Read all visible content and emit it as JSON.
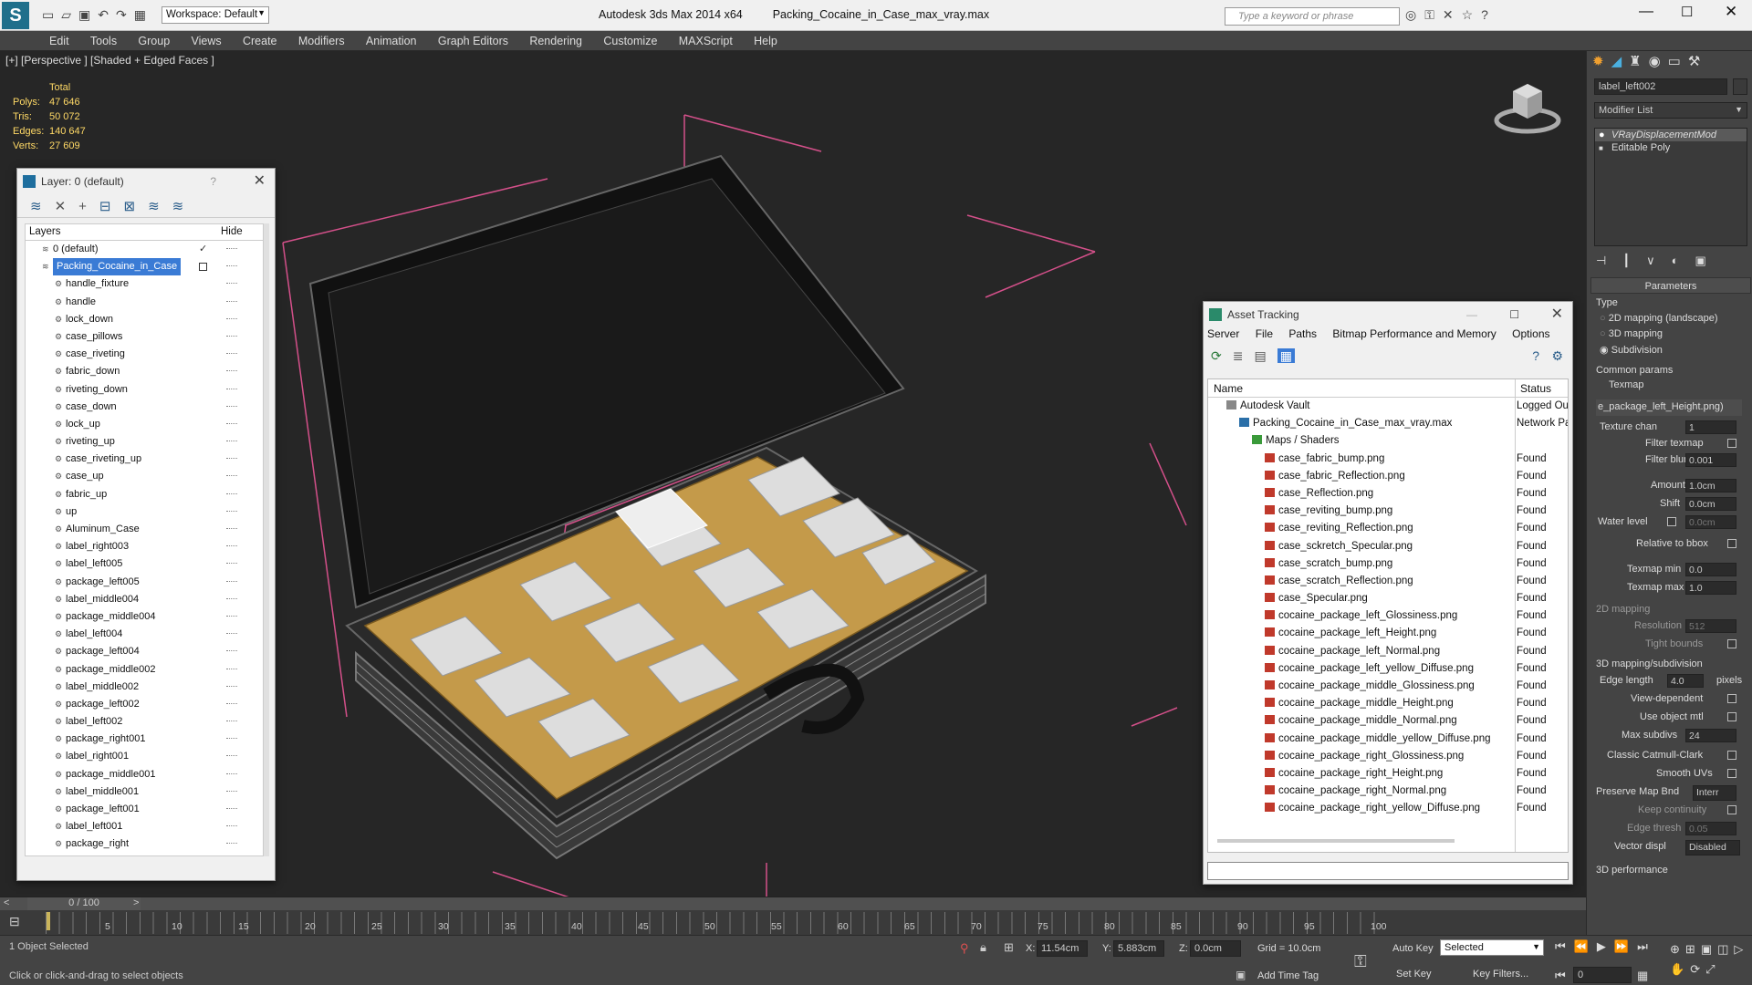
{
  "titlebar": {
    "workspace": "Workspace: Default",
    "app_title": "Autodesk 3ds Max  2014 x64",
    "file_title": "Packing_Cocaine_in_Case_max_vray.max",
    "search_placeholder": "Type a keyword or phrase"
  },
  "menu": [
    "Edit",
    "Tools",
    "Group",
    "Views",
    "Create",
    "Modifiers",
    "Animation",
    "Graph Editors",
    "Rendering",
    "Customize",
    "MAXScript",
    "Help"
  ],
  "viewport": {
    "label": "[+] [Perspective ] [Shaded + Edged Faces ]",
    "stats_header": "Total",
    "stats": [
      {
        "k": "Polys:",
        "v": "47 646"
      },
      {
        "k": "Tris:",
        "v": "50 072"
      },
      {
        "k": "Edges:",
        "v": "140 647"
      },
      {
        "k": "Verts:",
        "v": "27 609"
      }
    ]
  },
  "layer_window": {
    "title": "Layer: 0 (default)",
    "help": "?",
    "col_layers": "Layers",
    "col_hide": "Hide",
    "layers": [
      "0 (default)",
      "Packing_Cocaine_in_Case",
      "handle_fixture",
      "handle",
      "lock_down",
      "case_pillows",
      "case_riveting",
      "fabric_down",
      "riveting_down",
      "case_down",
      "lock_up",
      "riveting_up",
      "case_riveting_up",
      "case_up",
      "fabric_up",
      "up",
      "Aluminum_Case",
      "label_right003",
      "label_left005",
      "package_left005",
      "label_middle004",
      "package_middle004",
      "label_left004",
      "package_left004",
      "package_middle002",
      "label_middle002",
      "package_left002",
      "label_left002",
      "package_right001",
      "label_right001",
      "package_middle001",
      "label_middle001",
      "package_left001",
      "label_left001",
      "package_right"
    ]
  },
  "asset_window": {
    "title": "Asset Tracking",
    "menu": [
      "Server",
      "File",
      "Paths",
      "Bitmap Performance and Memory",
      "Options"
    ],
    "col_name": "Name",
    "col_status": "Status",
    "rows": [
      {
        "name": "Autodesk Vault",
        "status": "Logged Ou"
      },
      {
        "name": "Packing_Cocaine_in_Case_max_vray.max",
        "status": "Network Pa"
      },
      {
        "name": "Maps / Shaders",
        "status": ""
      },
      {
        "name": "case_fabric_bump.png",
        "status": "Found"
      },
      {
        "name": "case_fabric_Reflection.png",
        "status": "Found"
      },
      {
        "name": "case_Reflection.png",
        "status": "Found"
      },
      {
        "name": "case_reviting_bump.png",
        "status": "Found"
      },
      {
        "name": "case_reviting_Reflection.png",
        "status": "Found"
      },
      {
        "name": "case_sckretch_Specular.png",
        "status": "Found"
      },
      {
        "name": "case_scratch_bump.png",
        "status": "Found"
      },
      {
        "name": "case_scratch_Reflection.png",
        "status": "Found"
      },
      {
        "name": "case_Specular.png",
        "status": "Found"
      },
      {
        "name": "cocaine_package_left_Glossiness.png",
        "status": "Found"
      },
      {
        "name": "cocaine_package_left_Height.png",
        "status": "Found"
      },
      {
        "name": "cocaine_package_left_Normal.png",
        "status": "Found"
      },
      {
        "name": "cocaine_package_left_yellow_Diffuse.png",
        "status": "Found"
      },
      {
        "name": "cocaine_package_middle_Glossiness.png",
        "status": "Found"
      },
      {
        "name": "cocaine_package_middle_Height.png",
        "status": "Found"
      },
      {
        "name": "cocaine_package_middle_Normal.png",
        "status": "Found"
      },
      {
        "name": "cocaine_package_middle_yellow_Diffuse.png",
        "status": "Found"
      },
      {
        "name": "cocaine_package_right_Glossiness.png",
        "status": "Found"
      },
      {
        "name": "cocaine_package_right_Height.png",
        "status": "Found"
      },
      {
        "name": "cocaine_package_right_Normal.png",
        "status": "Found"
      },
      {
        "name": "cocaine_package_right_yellow_Diffuse.png",
        "status": "Found"
      }
    ]
  },
  "command_panel": {
    "object_name": "label_left002",
    "modifier_list": "Modifier List",
    "stack": [
      "VRayDisplacementMod",
      "Editable Poly"
    ],
    "parameters": "Parameters",
    "type_label": "Type",
    "types": [
      "2D mapping (landscape)",
      "3D mapping",
      "Subdivision"
    ],
    "common_params": "Common params",
    "texmap_label": "Texmap",
    "texmap_value": "e_package_left_Height.png)",
    "texture_chan": "Texture chan",
    "texture_chan_val": "1",
    "filter_texmap": "Filter texmap",
    "filter_blur": "Filter blur",
    "filter_blur_val": "0.001",
    "amount": "Amount",
    "amount_val": "1.0cm",
    "shift": "Shift",
    "shift_val": "0.0cm",
    "water_level": "Water level",
    "water_level_val": "0.0cm",
    "relative_bbox": "Relative to bbox",
    "texmap_min": "Texmap min",
    "texmap_min_val": "0.0",
    "texmap_max": "Texmap max",
    "texmap_max_val": "1.0",
    "mapping2d": "2D mapping",
    "resolution": "Resolution",
    "resolution_val": "512",
    "tight_bounds": "Tight bounds",
    "mapping3d": "3D mapping/subdivision",
    "edge_length": "Edge length",
    "edge_length_val": "4.0",
    "pixels": "pixels",
    "view_dependent": "View-dependent",
    "use_object_mtl": "Use object mtl",
    "max_subdivs": "Max subdivs",
    "max_subdivs_val": "24",
    "classic_catmull": "Classic Catmull-Clark",
    "smooth_uvs": "Smooth UVs",
    "preserve_map": "Preserve Map Bnd",
    "preserve_map_val": "Interr",
    "keep_continuity": "Keep continuity",
    "edge_thresh": "Edge thresh",
    "edge_thresh_val": "0.05",
    "vector_displ": "Vector displ",
    "vector_displ_val": "Disabled",
    "performance": "3D performance"
  },
  "timeline": {
    "frame": "0 / 100",
    "ticks": [
      "5",
      "10",
      "15",
      "20",
      "25",
      "30",
      "35",
      "40",
      "45",
      "50",
      "55",
      "60",
      "65",
      "70",
      "75",
      "80",
      "85",
      "90",
      "95",
      "100"
    ]
  },
  "status": {
    "selected": "1 Object Selected",
    "prompt": "Click or click-and-drag to select objects",
    "x_label": "X:",
    "x_val": "11.54cm",
    "y_label": "Y:",
    "y_val": "5.883cm",
    "z_label": "Z:",
    "z_val": "0.0cm",
    "grid": "Grid = 10.0cm",
    "auto_key": "Auto Key",
    "selected_dropdown": "Selected",
    "set_key": "Set Key",
    "key_filters": "Key Filters...",
    "add_time_tag": "Add Time Tag",
    "frame_field": "0"
  },
  "colors": {
    "viewport_bg": "#262626",
    "accent": "#3a7bd5",
    "stats": "#ffd966",
    "bbox": "#d4508a",
    "package": "#c49a4a"
  }
}
